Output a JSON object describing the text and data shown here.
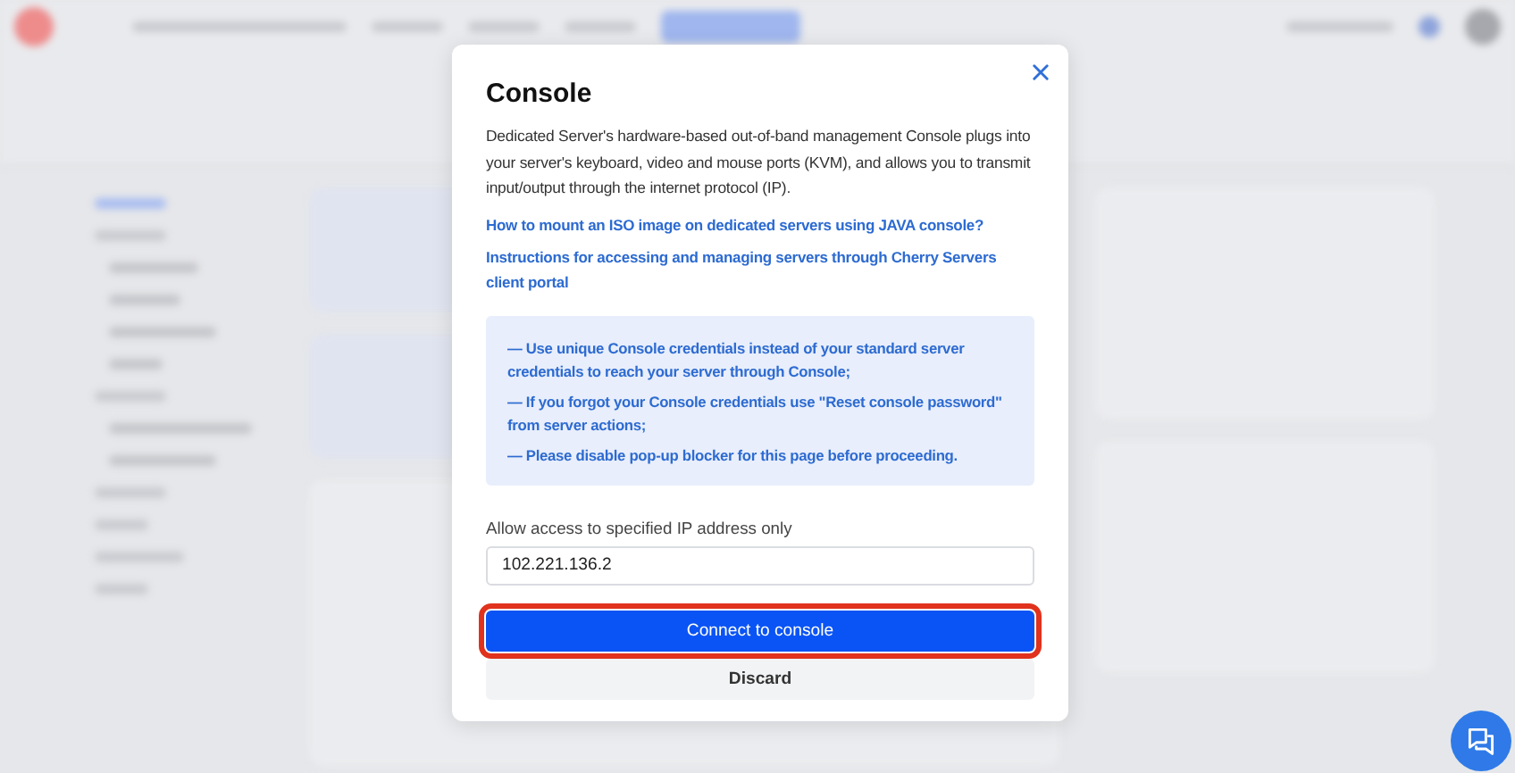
{
  "dialog": {
    "title": "Console",
    "description": "Dedicated Server's hardware-based out-of-band management Console plugs into your server's keyboard, video and mouse ports (KVM), and allows you to transmit input/output through the internet protocol (IP).",
    "links": [
      "How to mount an ISO image on dedicated servers using JAVA console?",
      "Instructions for accessing and managing servers through Cherry Servers client portal"
    ],
    "notes": [
      "— Use unique Console credentials instead of your standard server credentials to reach your server through Console;",
      "— If you forgot your Console credentials use \"Reset console password\" from server actions;",
      "— Please disable pop-up blocker for this page before proceeding."
    ],
    "ip_field": {
      "label": "Allow access to specified IP address only",
      "value": "102.221.136.2"
    },
    "buttons": [
      {
        "label": "Connect to console",
        "kind": "primary",
        "highlighted": true
      },
      {
        "label": "Discard",
        "kind": "secondary",
        "highlighted": false
      }
    ]
  }
}
